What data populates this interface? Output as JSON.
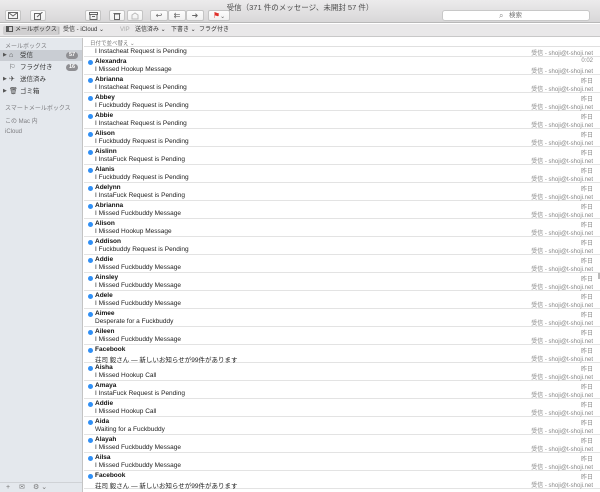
{
  "window": {
    "title": "受信（371 件のメッセージ、未開封 57 件）"
  },
  "toolbar": {
    "get_mail_icon": "envelope-icon",
    "compose_icon": "compose-icon",
    "archive_icon": "archive-icon",
    "delete_icon": "trash-icon",
    "junk_icon": "junk-icon",
    "reply_glyph": "↩",
    "reply_all_glyph": "⇇",
    "forward_glyph": "➜",
    "flag_glyph": "⚑",
    "dropdown_glyph": "⌄",
    "search_placeholder": "検索",
    "flag_color": "#e0302a"
  },
  "favorites": {
    "mailboxes": "メールボックス",
    "inbox": "受信 - iCloud ⌄",
    "vip": "VIP",
    "sent": "送信済み ⌄",
    "drafts": "下書き ⌄",
    "flagged": "フラグ付き"
  },
  "sidebar": {
    "section_mailboxes": "メールボックス",
    "items": [
      {
        "label": "受信",
        "icon": "inbox-tray-icon",
        "glyph": "⌂",
        "badge": "57",
        "selected": true
      },
      {
        "label": "フラグ付き",
        "icon": "flag-icon",
        "glyph": "⚐",
        "badge": "16",
        "selected": false
      },
      {
        "label": "送信済み",
        "icon": "sent-icon",
        "glyph": "✈",
        "badge": "",
        "selected": false
      },
      {
        "label": "ゴミ箱",
        "icon": "trash-icon",
        "glyph": "🗑",
        "badge": "",
        "selected": false
      }
    ],
    "section_smart": "スマートメールボックス",
    "section_mac": "この Mac 内",
    "section_icloud": "iCloud",
    "bottom": {
      "add": "+",
      "compose": "✉",
      "gear": "⚙ ⌄"
    }
  },
  "list": {
    "sort_label": "日付で並べ替え ⌄",
    "accent_color": "#2f8ff5",
    "first_partial": {
      "subject": "I Instacheat Request is Pending",
      "account": "受信 - shoji@t-shoji.net"
    },
    "messages": [
      {
        "sender": "Alexandra",
        "date": "0:02",
        "subject": "I Missed Hookup Message",
        "account": "受信 - shoji@t-shoji.net"
      },
      {
        "sender": "Abrianna",
        "date": "昨日",
        "subject": "I Instacheat Request is Pending",
        "account": "受信 - shoji@t-shoji.net"
      },
      {
        "sender": "Abbey",
        "date": "昨日",
        "subject": "I Fuckbuddy Request is Pending",
        "account": "受信 - shoji@t-shoji.net"
      },
      {
        "sender": "Abbie",
        "date": "昨日",
        "subject": "I Instacheat Request is Pending",
        "account": "受信 - shoji@t-shoji.net"
      },
      {
        "sender": "Alison",
        "date": "昨日",
        "subject": "I Fuckbuddy Request is Pending",
        "account": "受信 - shoji@t-shoji.net"
      },
      {
        "sender": "Aislinn",
        "date": "昨日",
        "subject": "I InstaFuck Request is Pending",
        "account": "受信 - shoji@t-shoji.net"
      },
      {
        "sender": "Alanis",
        "date": "昨日",
        "subject": "I Fuckbuddy Request is Pending",
        "account": "受信 - shoji@t-shoji.net"
      },
      {
        "sender": "Adelynn",
        "date": "昨日",
        "subject": "I InstaFuck Request is Pending",
        "account": "受信 - shoji@t-shoji.net"
      },
      {
        "sender": "Abrianna",
        "date": "昨日",
        "subject": "I Missed Fuckbuddy Message",
        "account": "受信 - shoji@t-shoji.net"
      },
      {
        "sender": "Alison",
        "date": "昨日",
        "subject": "I Missed Hookup Message",
        "account": "受信 - shoji@t-shoji.net"
      },
      {
        "sender": "Addison",
        "date": "昨日",
        "subject": "I Fuckbuddy Request is Pending",
        "account": "受信 - shoji@t-shoji.net"
      },
      {
        "sender": "Addie",
        "date": "昨日",
        "subject": "I Missed Fuckbuddy Message",
        "account": "受信 - shoji@t-shoji.net"
      },
      {
        "sender": "Ainsley",
        "date": "昨日",
        "subject": "I Missed Fuckbuddy Message",
        "account": "受信 - shoji@t-shoji.net"
      },
      {
        "sender": "Adele",
        "date": "昨日",
        "subject": "I Missed Fuckbuddy Message",
        "account": "受信 - shoji@t-shoji.net"
      },
      {
        "sender": "Aimee",
        "date": "昨日",
        "subject": "Desperate for a Fuckbuddy",
        "account": "受信 - shoji@t-shoji.net"
      },
      {
        "sender": "Aileen",
        "date": "昨日",
        "subject": "I Missed Fuckbuddy Message",
        "account": "受信 - shoji@t-shoji.net"
      },
      {
        "sender": "Facebook",
        "date": "昨日",
        "subject": "荘司 毅さん — 新しいお知らせが99件があります",
        "account": "受信 - shoji@t-shoji.net"
      },
      {
        "sender": "Aisha",
        "date": "昨日",
        "subject": "I Missed Hookup Call",
        "account": "受信 - shoji@t-shoji.net"
      },
      {
        "sender": "Amaya",
        "date": "昨日",
        "subject": "I InstaFuck Request is Pending",
        "account": "受信 - shoji@t-shoji.net"
      },
      {
        "sender": "Addie",
        "date": "昨日",
        "subject": "I Missed Hookup Call",
        "account": "受信 - shoji@t-shoji.net"
      },
      {
        "sender": "Aida",
        "date": "昨日",
        "subject": "Waiting for a Fuckbuddy",
        "account": "受信 - shoji@t-shoji.net"
      },
      {
        "sender": "Alayah",
        "date": "昨日",
        "subject": "I Missed Fuckbuddy Message",
        "account": "受信 - shoji@t-shoji.net"
      },
      {
        "sender": "Ailsa",
        "date": "昨日",
        "subject": "I Missed Fuckbuddy Message",
        "account": "受信 - shoji@t-shoji.net"
      },
      {
        "sender": "Facebook",
        "date": "昨日",
        "subject": "荘司 毅さん — 新しいお知らせが99件があります",
        "account": "受信 - shoji@t-shoji.net"
      }
    ]
  }
}
